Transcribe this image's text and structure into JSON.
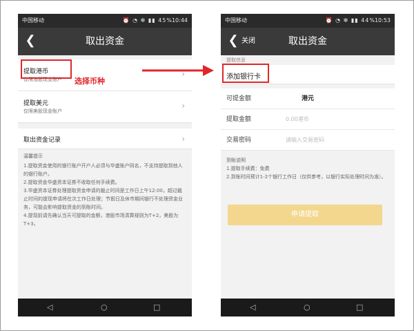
{
  "status": {
    "carrier": "中国移动",
    "icons": "⏰ ◔ ✻ ▮▮ 45%",
    "time1": "10:44",
    "icons2": "⏰ ◔ ✻ ▮▮ 44%",
    "time2": "10:53"
  },
  "screen1": {
    "title": "取出资金",
    "items": [
      {
        "title": "提取港币",
        "sub": "仅限港股现金账户"
      },
      {
        "title": "提取美元",
        "sub": "仅限美股现金账户"
      },
      {
        "title": "取出资金记录"
      }
    ],
    "tips_title": "温馨提示",
    "tips": [
      "1.提取资金使用的银行账户开户人必须与华盛账户同名，不支持提取到他人的银行账户。",
      "2.提取资金华盛资本证券不收取任何手续费。",
      "3.华盛资本证券处理提取资金申请的截止时间是工作日上午12:00，超过截止时间的提现申请将在次工作日处理；节假日及休市期间银行不处理资金业务，可能会影响提取资金的到账时间。",
      "4.提现前请先确认当天可提取的金额，港股市场清算规则为T+2，美股为T+3。"
    ]
  },
  "annotation": {
    "label": "选择币种"
  },
  "screen2": {
    "title": "取出资金",
    "close": "关闭",
    "section_label": "提取信息",
    "add_bank": "添加银行卡",
    "fields": [
      {
        "key": "可提金额",
        "value": "港元"
      },
      {
        "key": "提取金额",
        "placeholder": "0.00港币"
      },
      {
        "key": "交易密码",
        "placeholder": "请输入交易密码"
      }
    ],
    "info_title": "到账说明",
    "info": [
      "1.提取手续费：免费",
      "2.到账时间预计1-2个银行工作日（仅供参考，以银行实际处理时间为准）。"
    ],
    "submit": "申请提取"
  },
  "colors": {
    "annotation": "#e0262a",
    "submit": "#f3d78e",
    "titlebar": "#3a3a3a"
  }
}
